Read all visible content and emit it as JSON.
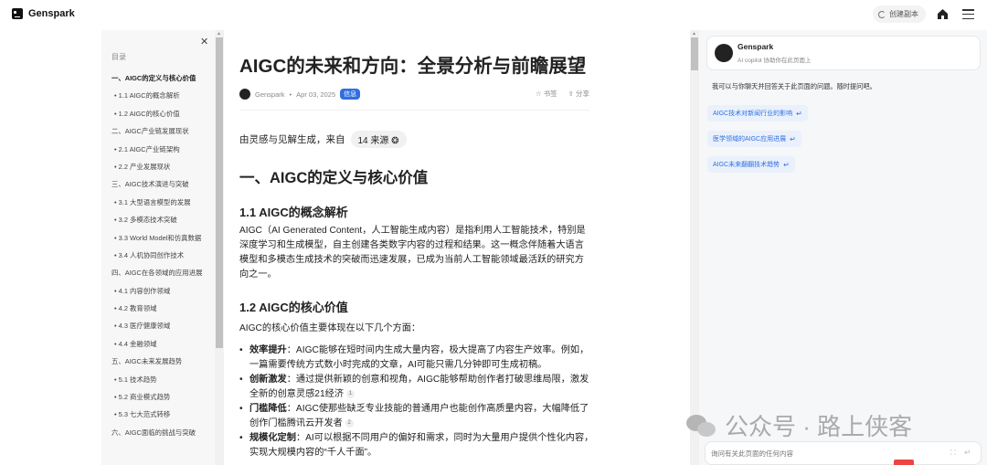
{
  "app": {
    "brand": "Genspark"
  },
  "topbar": {
    "create_copy": "创建副本"
  },
  "toc": {
    "title": "目录",
    "items": [
      {
        "label": "一、AIGC的定义与核心价值",
        "level": 1,
        "active": true
      },
      {
        "label": "1.1 AIGC的概念解析",
        "level": 2
      },
      {
        "label": "1.2 AIGC的核心价值",
        "level": 2
      },
      {
        "label": "二、AIGC产业链发展现状",
        "level": 1
      },
      {
        "label": "2.1 AIGC产业链架构",
        "level": 2
      },
      {
        "label": "2.2 产业发展现状",
        "level": 2
      },
      {
        "label": "三、AIGC技术演进与突破",
        "level": 1
      },
      {
        "label": "3.1 大型语言模型的发展",
        "level": 2
      },
      {
        "label": "3.2 多模态技术突破",
        "level": 2
      },
      {
        "label": "3.3 World Model和仿真数据",
        "level": 2
      },
      {
        "label": "3.4 人机协同创作技术",
        "level": 2
      },
      {
        "label": "四、AIGC在各领域的应用进展",
        "level": 1
      },
      {
        "label": "4.1 内容创作领域",
        "level": 2
      },
      {
        "label": "4.2 教育领域",
        "level": 2
      },
      {
        "label": "4.3 医疗健康领域",
        "level": 2
      },
      {
        "label": "4.4 金融领域",
        "level": 2
      },
      {
        "label": "五、AIGC未来发展趋势",
        "level": 1
      },
      {
        "label": "5.1 技术趋势",
        "level": 2
      },
      {
        "label": "5.2 商业模式趋势",
        "level": 2
      },
      {
        "label": "5.3 七大范式转移",
        "level": 2
      },
      {
        "label": "六、AIGC面临的挑战与突破",
        "level": 1
      }
    ]
  },
  "article": {
    "title": "AIGC的未来和方向：全景分析与前瞻展望",
    "author": "Genspark",
    "date": "Apr 03, 2025",
    "badge": "信息",
    "bookmark": "书签",
    "share": "分享",
    "sources_text": "由灵感与见解生成，来自",
    "sources_pill": "14 来源",
    "h1": "一、AIGC的定义与核心价值",
    "h2_a": "1.1 AIGC的概念解析",
    "p1": "AIGC（AI Generated Content，人工智能生成内容）是指利用人工智能技术，特别是深度学习和生成模型，自主创建各类数字内容的过程和结果。这一概念伴随着大语言模型和多模态生成技术的突破而迅速发展，已成为当前人工智能领域最活跃的研究方向之一。",
    "h2_b": "1.2 AIGC的核心价值",
    "p2": "AIGC的核心价值主要体现在以下几个方面：",
    "bullets": [
      {
        "term": "效率提升",
        "text": "：AIGC能够在短时间内生成大量内容，极大提高了内容生产效率。例如，一篇需要传统方式数小时完成的文章，AI可能只需几分钟即可生成初稿。",
        "cite": ""
      },
      {
        "term": "创新激发",
        "text": "：通过提供新颖的创意和视角，AIGC能够帮助创作者打破思维局限，激发全新的创意灵感21经济",
        "cite": "1"
      },
      {
        "term": "门槛降低",
        "text": "：AIGC使那些缺乏专业技能的普通用户也能创作高质量内容，大幅降低了创作门槛腾讯云开发者",
        "cite": "2"
      },
      {
        "term": "规模化定制",
        "text": "：AI可以根据不同用户的偏好和需求，同时为大量用户提供个性化内容，实现大规模内容的“千人千面”。",
        "cite": ""
      }
    ]
  },
  "chat": {
    "name": "Genspark",
    "subtitle": "AI copilot 协助你在此页面上",
    "intro": "我可以与你聊天并回答关于此页面的问题。随时提问吧。",
    "suggestions": [
      "AIGC技术对新闻行业的影响",
      "医学领域的AIGC应用进展",
      "AIGC未来翻翻技术趋势"
    ],
    "input_placeholder": "询问有关此页面的任何内容"
  },
  "watermark": {
    "text": "公众号 · 路上侠客"
  }
}
